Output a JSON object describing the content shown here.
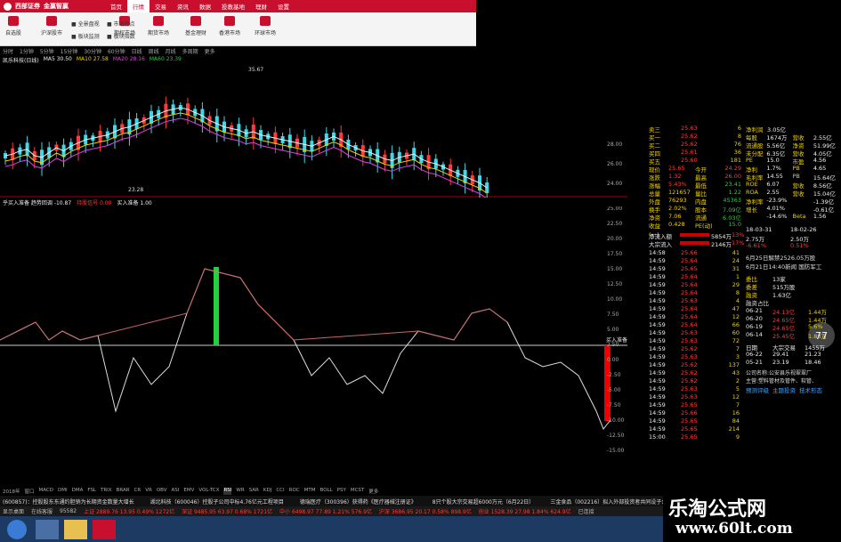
{
  "topbar": {
    "brand_a": "西部证券",
    "brand_b": "金赢智赢",
    "tabs": [
      "首页",
      "行情",
      "交易",
      "资讯",
      "数据",
      "投教基地",
      "理财",
      "设置"
    ],
    "active": 1
  },
  "toolbar": {
    "items": [
      "自选股",
      "沪深股市",
      "",
      "期权市场",
      "期货市场",
      "基金理财",
      "香港市场",
      "环球市场"
    ],
    "sub": [
      "全景盘视",
      "市场热点",
      "板块监测",
      "板块指数"
    ]
  },
  "period": [
    "分时",
    "1分钟",
    "5分钟",
    "15分钟",
    "30分钟",
    "60分钟",
    "日线",
    "周线",
    "月线",
    "多周期",
    "更多"
  ],
  "ma": {
    "name": "凯乐科技(日线)",
    "items": [
      {
        "t": "MA5 30.50",
        "c": "#eee"
      },
      {
        "t": "MA10 27.58",
        "c": "#f0d000"
      },
      {
        "t": "MA20 28.16",
        "c": "#e040e0"
      },
      {
        "t": "MA60 23.39",
        "c": "#23d13c"
      }
    ]
  },
  "kchart": {
    "high": "35.67",
    "low": "23.28",
    "ticks": [
      "28.00",
      "26.00",
      "24.00"
    ]
  },
  "indicator": {
    "legend": [
      "乎买入准备 趋势回调 -10.87",
      "持股信号 0.00",
      "买入准备 1.00"
    ],
    "buy_label": "买入准备",
    "ticks": [
      "25.00",
      "22.50",
      "20.00",
      "17.50",
      "15.00",
      "12.50",
      "10.00",
      "7.50",
      "5.00",
      "2.50",
      "0.00",
      "-2.50",
      "-5.00",
      "-7.50",
      "-10.00",
      "-12.50",
      "-15.00"
    ]
  },
  "quote": {
    "asks": [
      {
        "l": "卖三",
        "p": "25.63",
        "v": "6"
      },
      {
        "l": "买一",
        "p": "25.62",
        "v": "8"
      },
      {
        "l": "买二",
        "p": "25.62",
        "v": "76"
      },
      {
        "l": "买四",
        "p": "25.61",
        "v": "36"
      },
      {
        "l": "买五",
        "p": "25.60",
        "v": "181"
      }
    ],
    "stats": [
      [
        "现价",
        "25.65",
        "今开",
        "24.29"
      ],
      [
        "涨跌",
        "1.32",
        "最高",
        "26.00"
      ],
      [
        "涨幅",
        "5.43%",
        "最低",
        "23.41"
      ],
      [
        "总量",
        "121657",
        "量比",
        "1.22"
      ],
      [
        "外盘",
        "76293",
        "内盘",
        "45363"
      ],
      [
        "换手",
        "2.02%",
        "股本",
        "7.09亿"
      ],
      [
        "净资",
        "7.06",
        "流通",
        "6.03亿"
      ],
      [
        "收益(一)",
        "0.428",
        "PE(动)",
        "15.0"
      ]
    ],
    "flow": [
      [
        "净流入额",
        "5854万",
        "13%"
      ],
      [
        "大宗流入",
        "2146万",
        "17%"
      ]
    ],
    "ticks": [
      [
        "14:58",
        "25.66",
        "41"
      ],
      [
        "14:59",
        "25.64",
        "24"
      ],
      [
        "14:59",
        "25.65",
        "31"
      ],
      [
        "14:59",
        "25.64",
        "1"
      ],
      [
        "14:59",
        "25.64",
        "29"
      ],
      [
        "14:59",
        "25.64",
        "8"
      ],
      [
        "14:59",
        "25.63",
        "4"
      ],
      [
        "14:59",
        "25.64",
        "47"
      ],
      [
        "14:59",
        "25.64",
        "12"
      ],
      [
        "14:59",
        "25.64",
        "66"
      ],
      [
        "14:59",
        "25.63",
        "60"
      ],
      [
        "14:59",
        "25.63",
        "72"
      ],
      [
        "14:59",
        "25.62",
        "7"
      ],
      [
        "14:59",
        "25.63",
        "3"
      ],
      [
        "14:59",
        "25.62",
        "137"
      ],
      [
        "14:59",
        "25.62",
        "43"
      ],
      [
        "14:59",
        "25.62",
        "2"
      ],
      [
        "14:59",
        "25.63",
        "5"
      ],
      [
        "14:59",
        "25.63",
        "12"
      ],
      [
        "14:59",
        "25.65",
        "7"
      ],
      [
        "14:59",
        "25.66",
        "16"
      ],
      [
        "14:59",
        "25.65",
        "84"
      ],
      [
        "14:59",
        "25.65",
        "214"
      ],
      [
        "15:00",
        "25.65",
        "9"
      ]
    ]
  },
  "fin": {
    "rows": [
      [
        "净利润",
        "3.05亿"
      ],
      [
        "每股",
        "1674万",
        "营收",
        "2.55亿"
      ],
      [
        "流通股",
        "5.56亿",
        "净资",
        "51.99亿"
      ],
      [
        "未分配",
        "6.35亿",
        "营收",
        "4.05亿"
      ],
      [
        "PE",
        "15.0",
        "市盈",
        "4.56"
      ],
      [
        "净利",
        "1.7%",
        "PB",
        "4.65"
      ],
      [
        "毛利率",
        "14.55",
        "PB",
        "15.64亿"
      ],
      [
        "ROE",
        "6.07",
        "营收",
        "8.56亿"
      ],
      [
        "ROA",
        "2.55",
        "营收",
        "15.04亿"
      ],
      [
        "净利率",
        "-23.9%",
        "",
        "-1.39亿"
      ],
      [
        "增长",
        "4.01%",
        "",
        "-0.61亿"
      ],
      [
        "",
        "-14.6%",
        "Beta",
        "1.56"
      ]
    ],
    "dates": [
      "18-03-31",
      "18-02-26"
    ],
    "shareholders": [
      "2.75万",
      "2.50万"
    ],
    "pct": [
      "-6.61%",
      "0.51%"
    ],
    "news": [
      "6月25日解禁2526.05万股",
      "6月21日14:40新闻 国防军工"
    ],
    "kv": [
      [
        "委比",
        "13家"
      ],
      [
        "委差",
        "515万股"
      ],
      [
        "融资",
        "1.63亿"
      ]
    ],
    "margin_title": "融资占比",
    "margin": [
      [
        "06-21",
        "24.13亿",
        "1.44万"
      ],
      [
        "06-20",
        "24.65亿",
        "1.44万"
      ],
      [
        "06-19",
        "24.65亿",
        "5.6%"
      ],
      [
        "06-14",
        "25.45亿",
        "1.88万"
      ]
    ],
    "block": [
      [
        "日期",
        "大宗交易",
        "1455万"
      ],
      [
        "06-22",
        "29.41",
        "21.23"
      ],
      [
        "05-21",
        "23.19",
        "18.46"
      ]
    ],
    "profile": [
      "公司名称:公安县乐视翠翠厂",
      "主营:塑料管材及管件、软管、",
      "预测评级",
      "主题投资",
      "技术形态"
    ],
    "gauge": "77"
  },
  "tabs": [
    "2018年",
    "窗口",
    "MACD",
    "DMI",
    "DMA",
    "FSL",
    "TRIX",
    "BRAR",
    "CR",
    "VR",
    "OBV",
    "ASI",
    "EMV",
    "VOL-TCX",
    "RSI",
    "WR",
    "SAR",
    "KDJ",
    "CCI",
    "ROC",
    "MTM",
    "BOLL",
    "PSY",
    "MCST",
    "更多"
  ],
  "tabs2": [
    "扩展>>",
    "基本面",
    "财务分析",
    "综合资讯",
    "行业资讯"
  ],
  "news": [
    "(600857)：控股股东东通约胆销为长期资金数量大增长",
    "湖北科技（600046）控股子公司中标4.76亿元工程项目",
    "德瑞医疗（300396）获得药《医疗器械注册证》",
    "8只个股大宗交易超6000万元（6月22日）",
    "三金食品（002216）拟入外部投资者共同设子公司增资"
  ],
  "status": [
    "显示桌面",
    "在线客服",
    "95582",
    "上证 2889.76 13.95 0.49% 1272亿",
    "深证 9485.95 63.97 0.68% 1721亿",
    "中小 6498.97 77.89 1.21% 576.9亿",
    "沪深 3686.95 20.17 0.58% 898.9亿",
    "创业 1528.39 27.98 1.84% 624.9亿",
    "已连接"
  ],
  "watermark": {
    "cn": "乐淘公式网",
    "url": "www.60lt.com"
  }
}
